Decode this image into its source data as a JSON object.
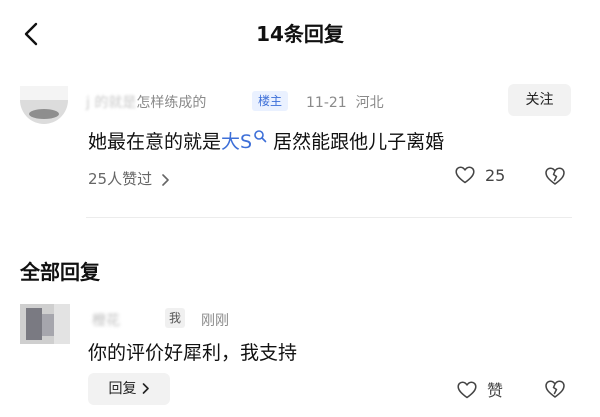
{
  "header": {
    "title": "14条回复",
    "back_icon": "chevron-left-icon"
  },
  "main_comment": {
    "username": "怎样练成的",
    "username_blurred": "j 的就是",
    "badge": "楼主",
    "date": "11-21",
    "location": "河北",
    "follow_label": "关注",
    "text_before": "她最在意的就是",
    "link_text": "大S",
    "text_after": "居然能跟他儿子离婚",
    "replies_text": "25人赞过",
    "like_count": "25"
  },
  "section_title": "全部回复",
  "reply": {
    "username_blurred": "橙花",
    "tag": "我",
    "time": "刚刚",
    "text": "你的评价好犀利，我支持",
    "reply_button": "回复",
    "like_label": "赞"
  },
  "colors": {
    "link": "#3d6fd8",
    "badge_bg": "#eaf1ff",
    "button_bg": "#f2f2f2"
  }
}
